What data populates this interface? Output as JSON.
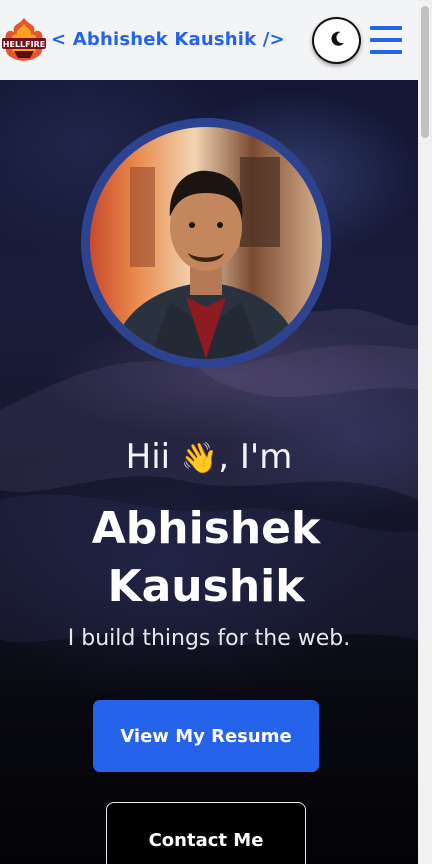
{
  "navbar": {
    "logo_text": "HELLFIRE",
    "brand": "< Abhishek Kaushik />",
    "theme_toggle_icon": "moon-icon",
    "menu_icon": "hamburger-menu-icon"
  },
  "hero": {
    "greeting_prefix": "Hii",
    "wave_emoji": "👋",
    "greeting_suffix": ", I'm",
    "name": "Abhishek Kaushik",
    "tagline": "I build things for the web.",
    "resume_button": "View My Resume",
    "contact_button": "Contact Me"
  },
  "colors": {
    "accent": "#2563eb",
    "avatar_ring": "#2e4390",
    "navbar_bg": "#f3f4f6"
  }
}
